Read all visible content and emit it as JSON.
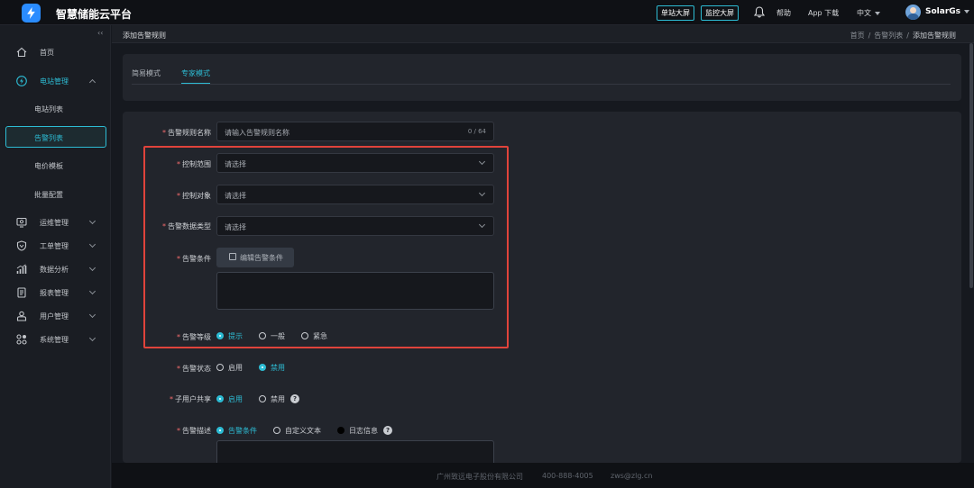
{
  "header": {
    "brand": "智慧储能云平台",
    "single_screen": "单站大屏",
    "monitor_screen": "监控大屏",
    "help": "帮助",
    "app_download": "App 下载",
    "language": "中文",
    "username": "SolarGs"
  },
  "sidebar": {
    "collapse": "‹‹",
    "home": "首页",
    "station_mgmt": "电站管理",
    "sub_items": [
      "电站列表",
      "告警列表",
      "电价模板",
      "批量配置"
    ],
    "menu": [
      "运维管理",
      "工单管理",
      "数据分析",
      "报表管理",
      "用户管理",
      "系统管理"
    ]
  },
  "breadcrumb": {
    "title": "添加告警规则",
    "items": [
      "首页",
      "告警列表",
      "添加告警规则"
    ],
    "sep": "/"
  },
  "tabs": [
    "简易模式",
    "专家模式"
  ],
  "form": {
    "rule_name_label": "告警规则名称",
    "rule_name_placeholder": "请输入告警规则名称",
    "rule_name_count": "0 / 64",
    "scope_label": "控制范围",
    "scope_placeholder": "请选择",
    "object_label": "控制对象",
    "object_placeholder": "请选择",
    "datatype_label": "告警数据类型",
    "datatype_placeholder": "请选择",
    "condition_label": "告警条件",
    "edit_condition": "编辑告警条件",
    "level_label": "告警等级",
    "level_options": [
      "提示",
      "一般",
      "紧急"
    ],
    "status_label": "告警状态",
    "status_options": [
      "启用",
      "禁用"
    ],
    "share_label": "子用户共享",
    "share_options": [
      "启用",
      "禁用"
    ],
    "desc_label": "告警描述",
    "desc_options": [
      "告警条件",
      "自定义文本",
      "日志信息"
    ],
    "help_icon": "?"
  },
  "footer": {
    "company": "广州致远电子股份有限公司",
    "phone": "400-888-4005",
    "email": "zws@zlg.cn"
  },
  "colors": {
    "accent": "#2dbcd4",
    "highlight": "#e0433b",
    "required": "#f56c6c"
  }
}
